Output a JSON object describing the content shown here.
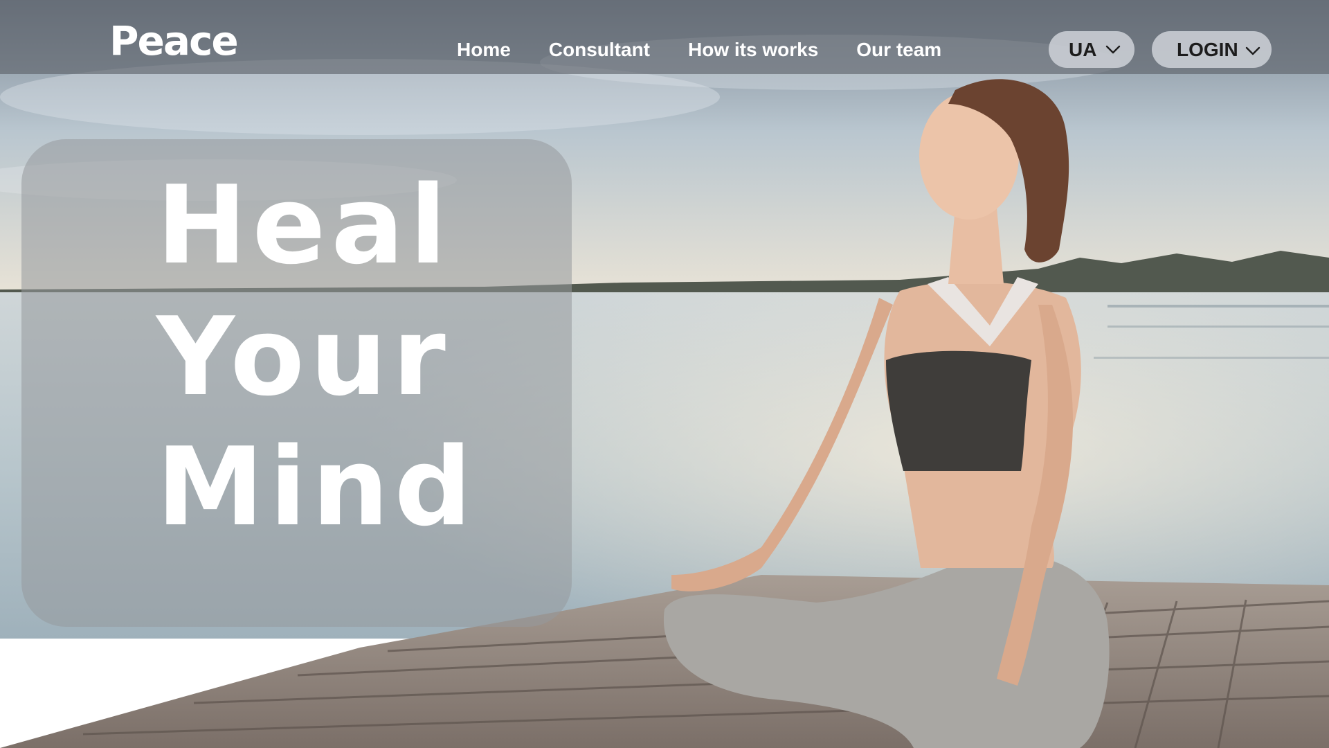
{
  "brand": {
    "logo_text": "Peace"
  },
  "nav": {
    "links": [
      {
        "label": "Home"
      },
      {
        "label": "Consultant"
      },
      {
        "label": "How its works"
      },
      {
        "label": "Our team"
      }
    ]
  },
  "language_selector": {
    "value": "UA",
    "icon": "chevron-down-icon"
  },
  "login_menu": {
    "label": "LOGIN",
    "icon": "chevron-down-icon"
  },
  "hero": {
    "lines": [
      "Heal",
      "Your",
      "Mind"
    ]
  },
  "colors": {
    "header_overlay": "#5A6068",
    "pill_bg": "#D2D6DC",
    "hero_text": "#FFFFFF",
    "card_overlay": "#96999C"
  }
}
